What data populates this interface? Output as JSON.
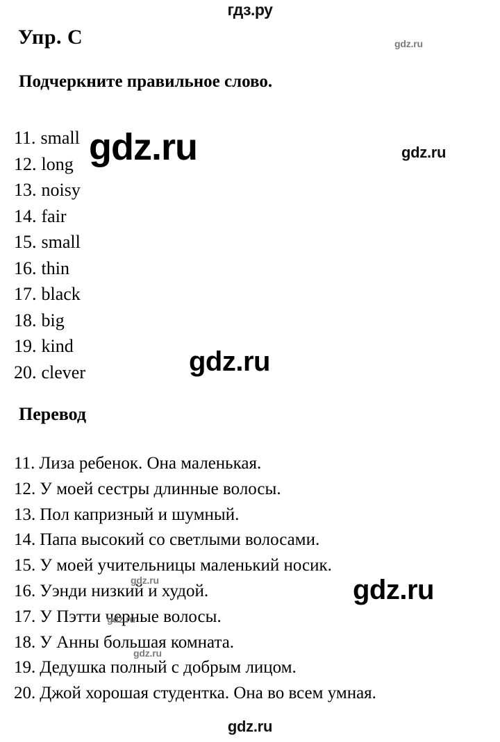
{
  "site": {
    "header_logo": "гдз.ру",
    "footer_logo": "gdz.ru"
  },
  "exercise": {
    "title": "Упр. C",
    "instruction": "Подчеркните правильное слово."
  },
  "answers": {
    "items": [
      {
        "number": "11.",
        "word": "small"
      },
      {
        "number": "12.",
        "word": "long"
      },
      {
        "number": "13.",
        "word": "noisy"
      },
      {
        "number": "14.",
        "word": "fair"
      },
      {
        "number": "15.",
        "word": "small"
      },
      {
        "number": "16.",
        "word": "thin"
      },
      {
        "number": "17.",
        "word": "black"
      },
      {
        "number": "18.",
        "word": "big"
      },
      {
        "number": "19.",
        "word": "kind"
      },
      {
        "number": "20.",
        "word": "clever"
      }
    ]
  },
  "translation": {
    "title": "Перевод",
    "items": [
      {
        "number": "11.",
        "text": "Лиза ребенок. Она маленькая."
      },
      {
        "number": "12.",
        "text": "У моей сестры длинные волосы."
      },
      {
        "number": "13.",
        "text": "Пол капризный и шумный."
      },
      {
        "number": "14.",
        "text": "Папа высокий со светлыми волосами."
      },
      {
        "number": "15.",
        "text": "У моей учительницы маленький носик."
      },
      {
        "number": "16.",
        "text": "Уэнди низкий и худой."
      },
      {
        "number": "17.",
        "text": "У Пэтти черные волосы."
      },
      {
        "number": "18.",
        "text": "У Анны большая комната."
      },
      {
        "number": "19.",
        "text": "Дедушка полный с добрым лицом."
      },
      {
        "number": "20.",
        "text": "Джой хорошая студентка. Она во всем умная."
      }
    ]
  },
  "watermarks": {
    "a": "gdz.ru",
    "b": "gdz.ru",
    "c": "gdz.ru",
    "d": "gdz.ru",
    "e": "gdz.ru",
    "f": "gdz.ru",
    "g": "gdz.ru",
    "h": "gdz.ru"
  },
  "colors": {
    "page_background": "#ffffff",
    "text": "#000000",
    "watermark_strong": "#000000",
    "watermark_faint": "#7b7b7b"
  }
}
